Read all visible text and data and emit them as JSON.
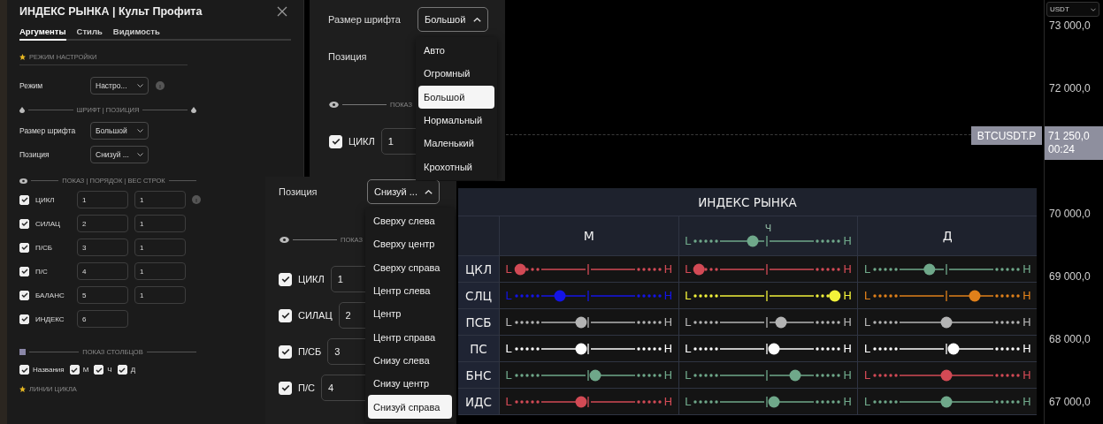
{
  "settings_dialog": {
    "title": "ИНДЕКС РЫНКА | Культ Профита",
    "tabs": [
      {
        "label": "Аргументы",
        "selected": true
      },
      {
        "label": "Стиль",
        "selected": false
      },
      {
        "label": "Видимость",
        "selected": false
      }
    ],
    "mode_section": "РЕЖИМ НАСТРОЙКИ",
    "mode": {
      "label": "Режим",
      "value": "Настро..."
    },
    "font_section": "ШРИФТ | ПОЗИЦИЯ",
    "font_size": {
      "label": "Размер шрифта",
      "value": "Большой"
    },
    "position": {
      "label": "Позиция",
      "value": "Снизуй ..."
    },
    "rows_section": "ПОКАЗ | ПОРЯДОК | ВЕС СТРОК",
    "rows": [
      {
        "name": "ЦИКЛ",
        "checked": true,
        "order": "1",
        "weight": "1"
      },
      {
        "name": "СИЛАЦ",
        "checked": true,
        "order": "2",
        "weight": "1"
      },
      {
        "name": "П/СБ",
        "checked": true,
        "order": "3",
        "weight": "1"
      },
      {
        "name": "П/С",
        "checked": true,
        "order": "4",
        "weight": "1"
      },
      {
        "name": "БАЛАНС",
        "checked": true,
        "order": "5",
        "weight": "1"
      },
      {
        "name": "ИНДЕКС",
        "checked": true,
        "order": "6"
      }
    ],
    "columns_section": "ПОКАЗ СТОЛБЦОВ",
    "columns": [
      {
        "label": "Названия",
        "checked": true
      },
      {
        "label": "М",
        "checked": true
      },
      {
        "label": "Ч",
        "checked": true
      },
      {
        "label": "Д",
        "checked": true
      }
    ],
    "cycle_section": "ЛИНИИ ЦИКЛА"
  },
  "font_popup": {
    "label": "Размер шрифта",
    "value": "Большой",
    "position_label": "Позиция",
    "show_section": "ПОКАЗ",
    "options": [
      {
        "label": "Авто",
        "selected": false
      },
      {
        "label": "Огромный",
        "selected": false
      },
      {
        "label": "Большой",
        "selected": true
      },
      {
        "label": "Нормальный",
        "selected": false
      },
      {
        "label": "Маленький",
        "selected": false
      },
      {
        "label": "Крохотный",
        "selected": false
      }
    ],
    "rows": [
      {
        "name": "ЦИКЛ",
        "checked": true,
        "order": "1"
      }
    ]
  },
  "position_popup": {
    "label": "Позиция",
    "value": "Снизуй ...",
    "show_section": "ПОКАЗ",
    "options": [
      {
        "label": "Сверху слева",
        "selected": false
      },
      {
        "label": "Сверху центр",
        "selected": false
      },
      {
        "label": "Сверху справа",
        "selected": false
      },
      {
        "label": "Центр слева",
        "selected": false
      },
      {
        "label": "Центр",
        "selected": false
      },
      {
        "label": "Центр справа",
        "selected": false
      },
      {
        "label": "Снизу слева",
        "selected": false
      },
      {
        "label": "Снизу центр",
        "selected": false
      },
      {
        "label": "Снизуй справа",
        "selected": true
      }
    ],
    "rows": [
      {
        "name": "ЦИКЛ",
        "checked": true,
        "order": "1"
      },
      {
        "name": "СИЛАЦ",
        "checked": true,
        "order": "2"
      },
      {
        "name": "П/СБ",
        "checked": true,
        "order": "3"
      },
      {
        "name": "П/С",
        "checked": true,
        "order": "4"
      }
    ]
  },
  "index_table": {
    "title": "ИНДЕКС РЫНКА",
    "columns": [
      {
        "label": "М"
      },
      {
        "label": "Ч",
        "gauge": {
          "low": "L",
          "high": "H",
          "color": "#6fa88a",
          "level": 0.4
        }
      },
      {
        "label": "Д"
      }
    ],
    "rows": [
      {
        "name": "ЦКЛ",
        "gauges": [
          {
            "low": "L",
            "high": "H",
            "color": "#d24a55",
            "level": 0.02
          },
          {
            "low": "L",
            "high": "H",
            "color": "#d24a55",
            "level": 0.02
          },
          {
            "low": "L",
            "high": "H",
            "color": "#6fa88a",
            "level": 0.38
          }
        ]
      },
      {
        "name": "СЛЦ",
        "gauges": [
          {
            "low": "L",
            "high": "H",
            "color": "#1414e6",
            "level": 0.3
          },
          {
            "low": "L",
            "high": "H",
            "color": "#f2f23a",
            "level": 0.98
          },
          {
            "low": "L",
            "high": "H",
            "color": "#e0801a",
            "level": 0.7
          }
        ]
      },
      {
        "name": "ПСБ",
        "gauges": [
          {
            "low": "L",
            "high": "H",
            "color": "#b4b4b4",
            "level": 0.45
          },
          {
            "low": "L",
            "high": "H",
            "color": "#b4b4b4",
            "level": 0.6
          },
          {
            "low": "L",
            "high": "H",
            "color": "#b4b4b4",
            "level": 0.5
          }
        ]
      },
      {
        "name": "ПС",
        "gauges": [
          {
            "low": "L",
            "high": "H",
            "color": "#ffffff",
            "level": 0.45
          },
          {
            "low": "L",
            "high": "H",
            "color": "#ffffff",
            "level": 0.55
          },
          {
            "low": "L",
            "high": "H",
            "color": "#ffffff",
            "level": 0.55
          }
        ]
      },
      {
        "name": "БНС",
        "gauges": [
          {
            "low": "L",
            "high": "H",
            "color": "#6fa88a",
            "level": 0.55
          },
          {
            "low": "L",
            "high": "H",
            "color": "#6fa88a",
            "level": 0.7
          },
          {
            "low": "L",
            "high": "H",
            "color": "#d24a55",
            "level": 0.5
          }
        ]
      },
      {
        "name": "ИДС",
        "gauges": [
          {
            "low": "L",
            "high": "H",
            "color": "#d24a55",
            "level": 0.45
          },
          {
            "low": "L",
            "high": "H",
            "color": "#6fa88a",
            "level": 0.55
          },
          {
            "low": "L",
            "high": "H",
            "color": "#6fa88a",
            "level": 0.5
          }
        ]
      }
    ]
  },
  "price_axis": {
    "currency": "USDT",
    "ticks": [
      "73 000,0",
      "72 000,0",
      "70 000,0",
      "69 000,0",
      "68 000,0",
      "67 000,0"
    ],
    "symbol": "BTCUSDT.P",
    "last_price": "71 250,0",
    "countdown": "00:24"
  }
}
